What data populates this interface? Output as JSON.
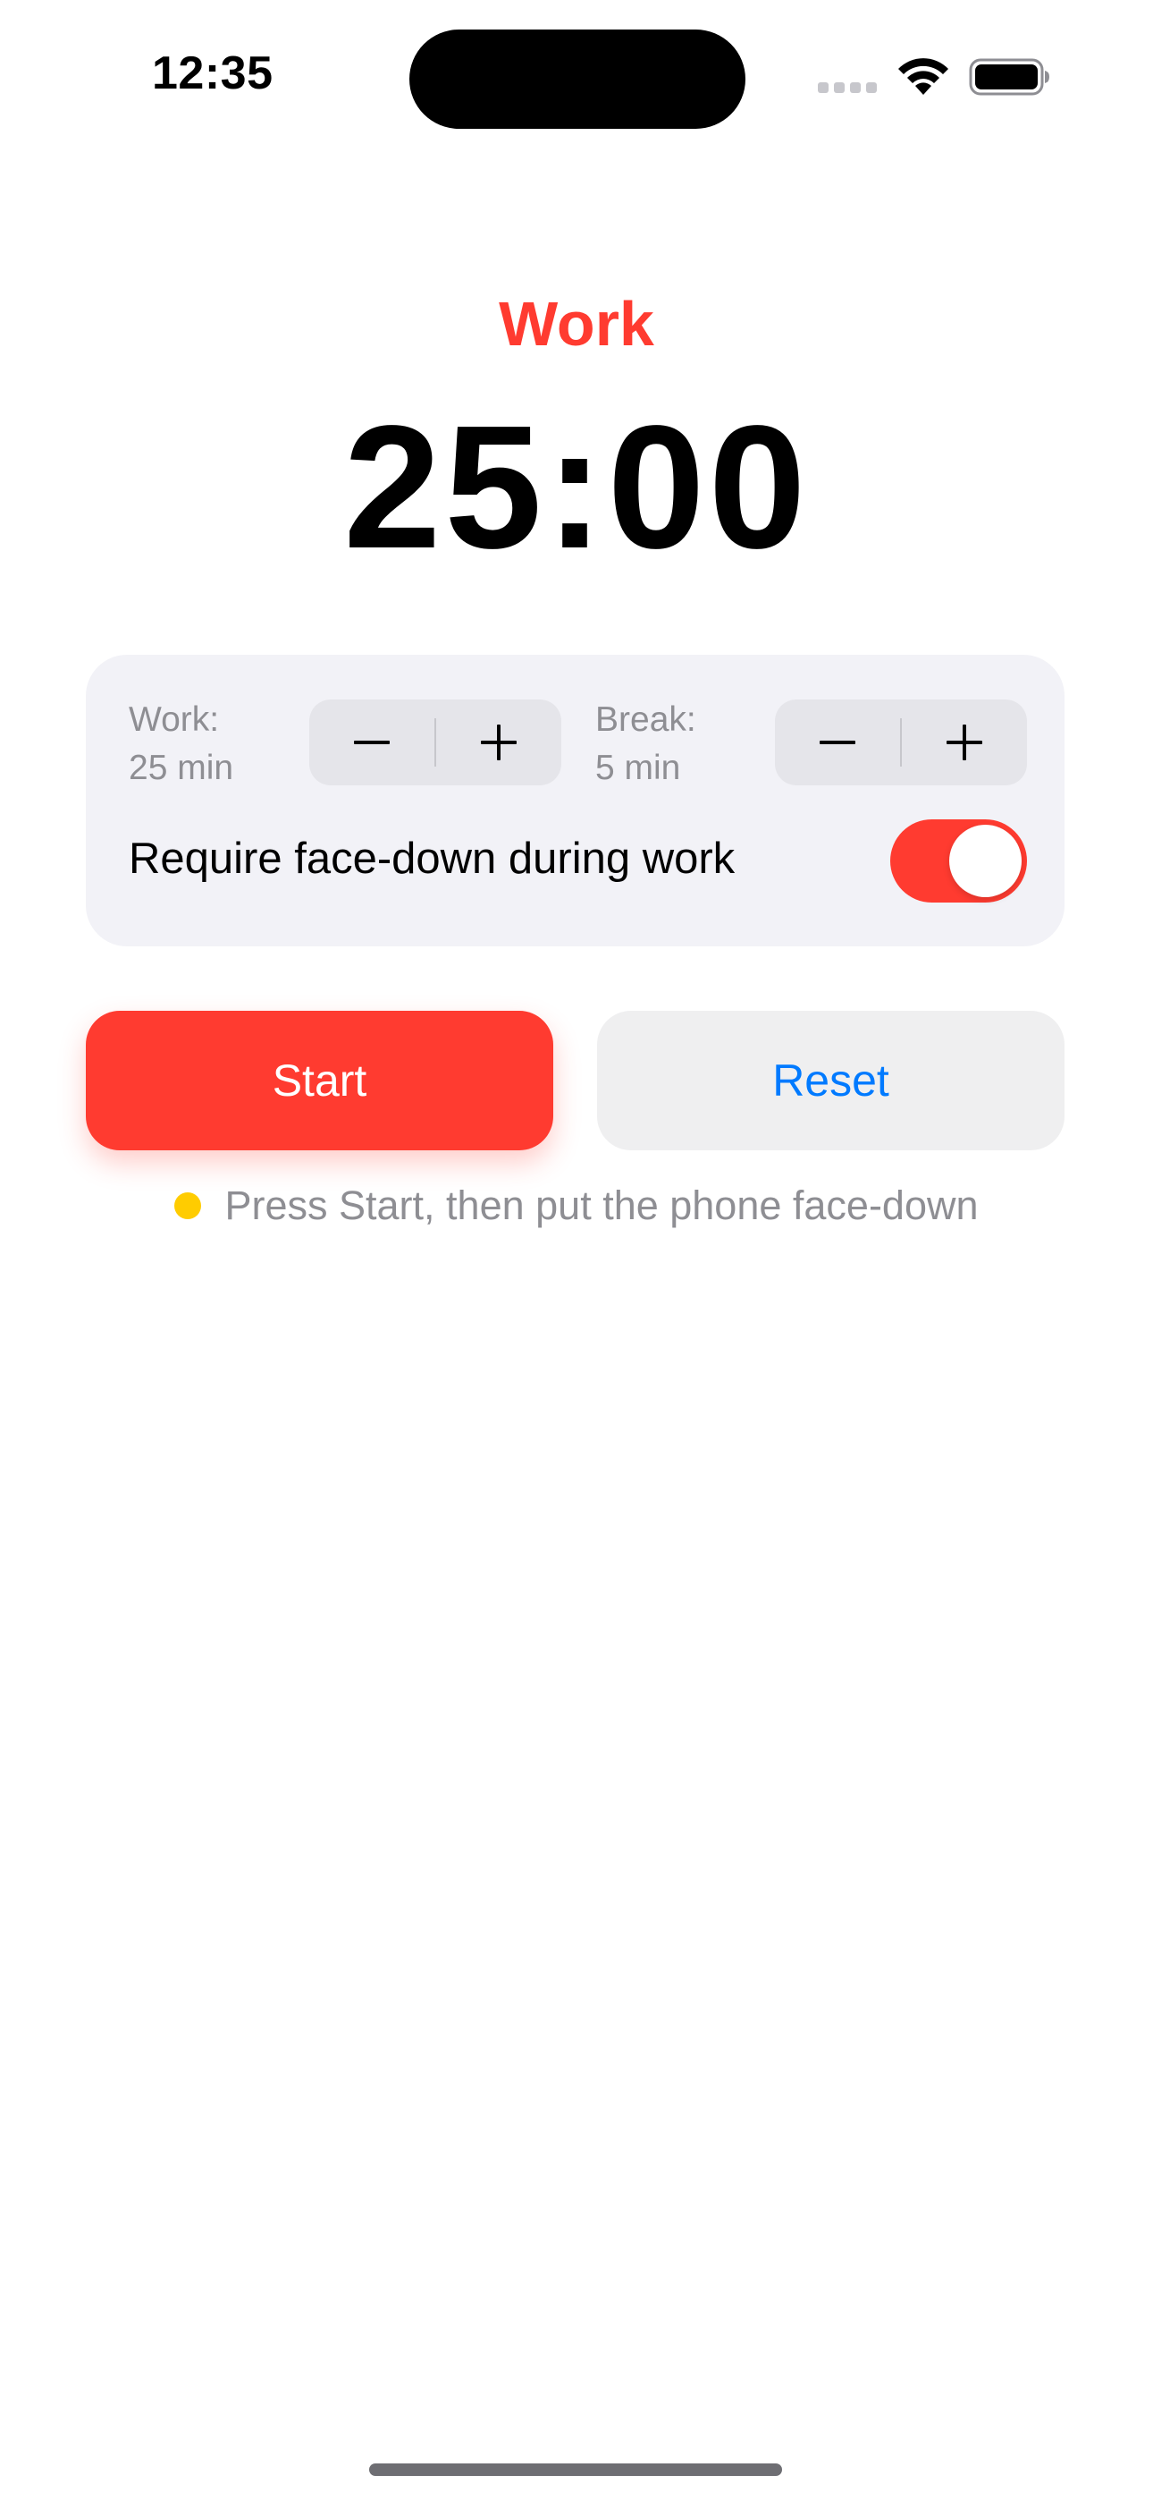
{
  "status_bar": {
    "time": "12:35",
    "icons": [
      "cellular-signal-icon",
      "wifi-icon",
      "battery-icon"
    ]
  },
  "timer": {
    "mode": "Work",
    "display": "25:00",
    "mode_color": "#ff3b30"
  },
  "settings": {
    "work": {
      "label": "Work:",
      "value": "25 min"
    },
    "break": {
      "label": "Break:",
      "value": "5 min"
    },
    "stepper_icons": [
      "minus-icon",
      "plus-icon"
    ],
    "toggle": {
      "label": "Require face-down during work",
      "on": true
    }
  },
  "actions": {
    "start_label": "Start",
    "reset_label": "Reset"
  },
  "hint": {
    "text": "Press Start, then put the phone face-down",
    "dot_color": "#ffcc00"
  },
  "colors": {
    "accent": "#ff3b30",
    "link": "#007aff",
    "card_background": "#f2f2f7"
  }
}
